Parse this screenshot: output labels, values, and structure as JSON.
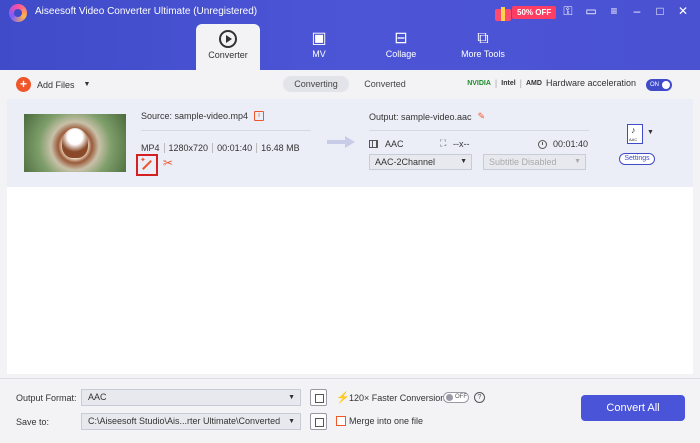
{
  "window": {
    "title": "Aiseesoft Video Converter Ultimate (Unregistered)",
    "promo_label": "50% OFF"
  },
  "nav": {
    "tabs": [
      {
        "label": "Converter",
        "icon": "converter-icon",
        "active": true
      },
      {
        "label": "MV",
        "icon": "tv-icon"
      },
      {
        "label": "Collage",
        "icon": "collage-icon"
      },
      {
        "label": "More Tools",
        "icon": "toolbox-icon"
      }
    ]
  },
  "toolbar": {
    "add_files_label": "Add Files",
    "segments": [
      "Converting",
      "Converted"
    ],
    "hw_brands": [
      "NVIDIA",
      "Intel",
      "AMD"
    ],
    "hw_label": "Hardware acceleration",
    "hw_toggle": "ON"
  },
  "file": {
    "source_label": "Source: sample-video.mp4",
    "format": "MP4",
    "resolution": "1280x720",
    "duration": "00:01:40",
    "size": "16.48 MB",
    "output_label": "Output: sample-video.aac",
    "out_format": "AAC",
    "out_resolution": "--x--",
    "out_duration": "00:01:40",
    "audio_channel": "AAC-2Channel",
    "subtitle": "Subtitle Disabled",
    "settings_label": "Settings"
  },
  "bottom": {
    "output_format_label": "Output Format:",
    "output_format_value": "AAC",
    "save_to_label": "Save to:",
    "save_to_value": "C:\\Aiseesoft Studio\\Ais...rter Ultimate\\Converted",
    "faster_label": "120× Faster Conversion",
    "faster_toggle": "OFF",
    "merge_label": "Merge into one file",
    "convert_all_label": "Convert All"
  },
  "colors": {
    "brand": "#4a54d8",
    "accent": "#f0562a",
    "highlight": "#d42020"
  }
}
